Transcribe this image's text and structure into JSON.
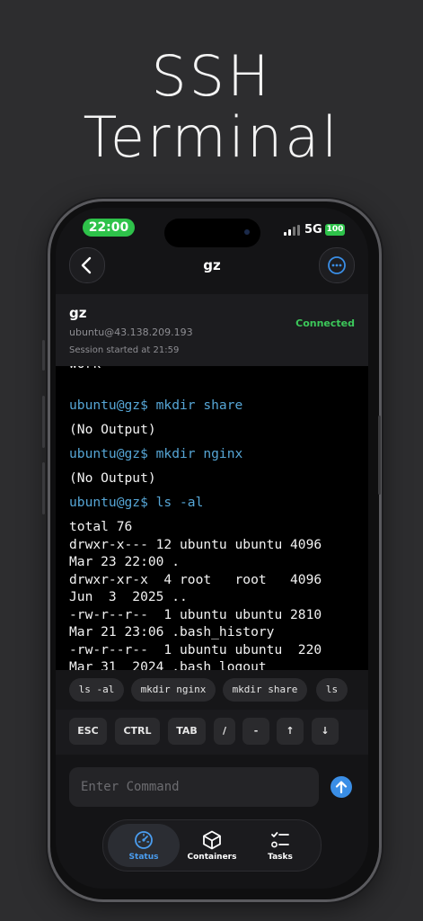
{
  "promo": {
    "line1": "SSH",
    "line2": "Terminal"
  },
  "status_bar": {
    "time": "22:00",
    "network": "5G",
    "battery": "100"
  },
  "nav": {
    "title": "gz",
    "back_icon": "chevron-left-icon",
    "more_icon": "ellipsis-circle-icon"
  },
  "session": {
    "name": "gz",
    "host": "ubuntu@43.138.209.193",
    "started": "Session started at 21:59",
    "status": "Connected"
  },
  "terminal": {
    "lines": [
      {
        "text": "work",
        "prompt": false
      },
      {
        "text": "ubuntu@gz$ mkdir share",
        "prompt": true
      },
      {
        "text": "(No Output)",
        "prompt": false
      },
      {
        "text": "ubuntu@gz$ mkdir nginx",
        "prompt": true
      },
      {
        "text": "(No Output)",
        "prompt": false
      },
      {
        "text": "ubuntu@gz$ ls -al",
        "prompt": true
      },
      {
        "text": "total 76",
        "prompt": false
      },
      {
        "text": "drwxr-x--- 12 ubuntu ubuntu 4096",
        "prompt": false
      },
      {
        "text": "Mar 23 22:00 .",
        "prompt": false
      },
      {
        "text": "drwxr-xr-x  4 root   root   4096",
        "prompt": false
      },
      {
        "text": "Jun  3  2025 ..",
        "prompt": false
      },
      {
        "text": "-rw-r--r--  1 ubuntu ubuntu 2810",
        "prompt": false
      },
      {
        "text": "Mar 21 23:06 .bash_history",
        "prompt": false
      },
      {
        "text": "-rw-r--r--  1 ubuntu ubuntu  220",
        "prompt": false
      },
      {
        "text": "Mar 31  2024 .bash_logout",
        "prompt": false
      }
    ]
  },
  "quick_commands": [
    "ls -al",
    "mkdir nginx",
    "mkdir share",
    "ls"
  ],
  "keys": [
    "ESC",
    "CTRL",
    "TAB",
    "/",
    "-",
    "↑",
    "↓"
  ],
  "input": {
    "placeholder": "Enter Command",
    "value": ""
  },
  "tabs": [
    {
      "label": "Status",
      "icon": "gauge-icon",
      "active": true
    },
    {
      "label": "Containers",
      "icon": "cube-icon",
      "active": false
    },
    {
      "label": "Tasks",
      "icon": "checklist-icon",
      "active": false
    }
  ],
  "colors": {
    "accent": "#3a8ee6",
    "connected": "#3cc85a",
    "prompt": "#56a6d6",
    "time_pill": "#2ec24a"
  }
}
